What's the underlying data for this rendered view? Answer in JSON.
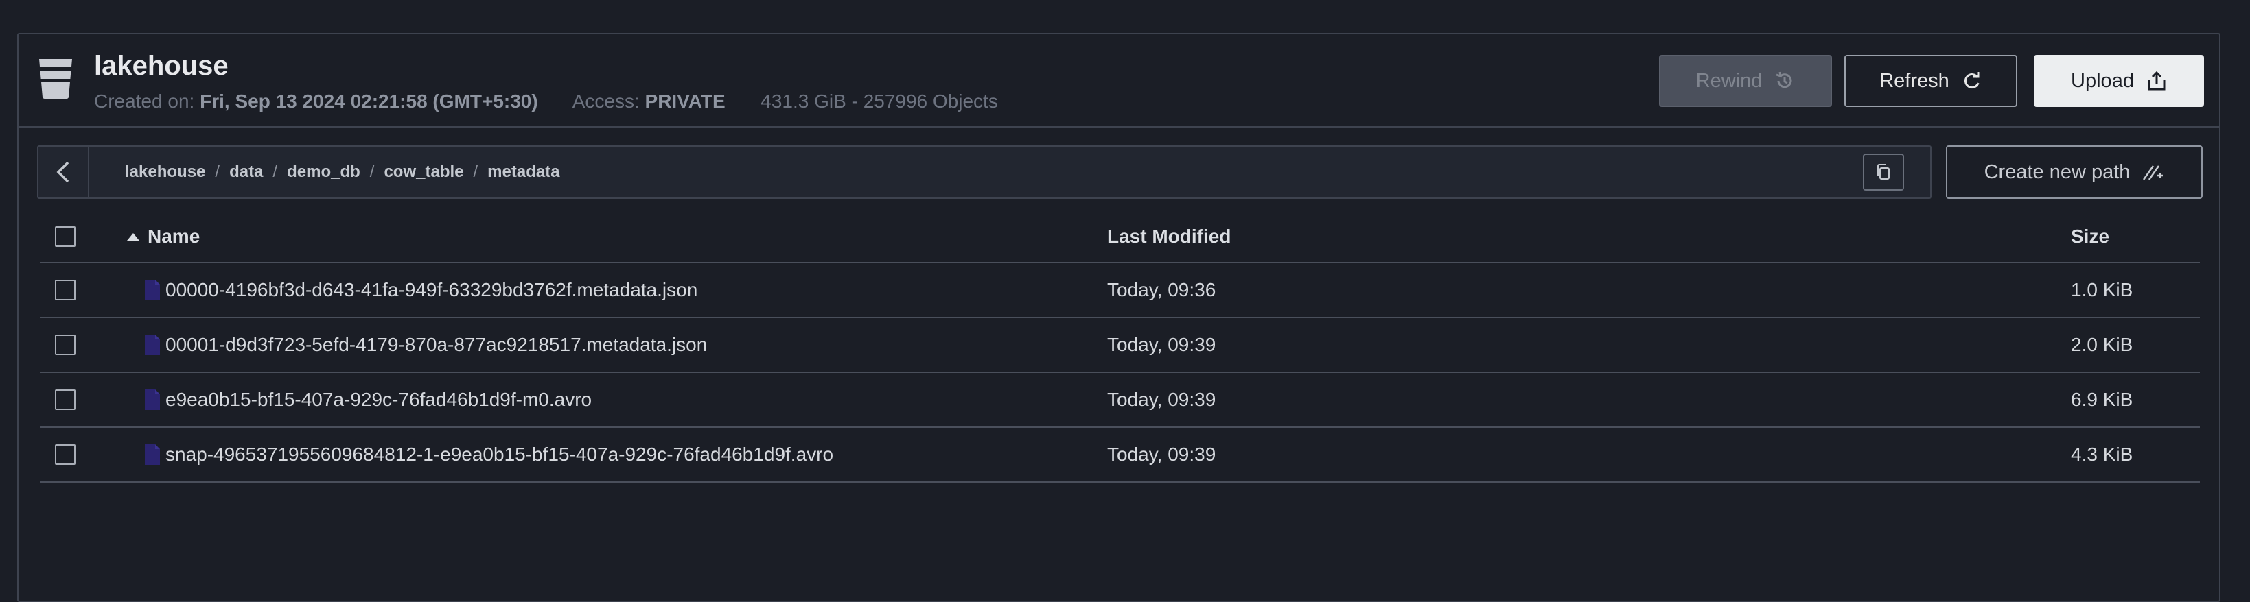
{
  "bucket": {
    "name": "lakehouse",
    "created_label": "Created on:",
    "created_value": "Fri, Sep 13 2024 02:21:58 (GMT+5:30)",
    "access_label": "Access:",
    "access_value": "PRIVATE",
    "usage": "431.3 GiB - 257996 Objects"
  },
  "actions": {
    "rewind": "Rewind",
    "refresh": "Refresh",
    "upload": "Upload",
    "create_path": "Create new path"
  },
  "breadcrumb": [
    "lakehouse",
    "data",
    "demo_db",
    "cow_table",
    "metadata"
  ],
  "table": {
    "headers": {
      "name": "Name",
      "modified": "Last Modified",
      "size": "Size"
    },
    "rows": [
      {
        "name": "00000-4196bf3d-d643-41fa-949f-63329bd3762f.metadata.json",
        "modified": "Today, 09:36",
        "size": "1.0 KiB"
      },
      {
        "name": "00001-d9d3f723-5efd-4179-870a-877ac9218517.metadata.json",
        "modified": "Today, 09:39",
        "size": "2.0 KiB"
      },
      {
        "name": "e9ea0b15-bf15-407a-929c-76fad46b1d9f-m0.avro",
        "modified": "Today, 09:39",
        "size": "6.9 KiB"
      },
      {
        "name": "snap-4965371955609684812-1-e9ea0b15-bf15-407a-929c-76fad46b1d9f.avro",
        "modified": "Today, 09:39",
        "size": "4.3 KiB"
      }
    ]
  },
  "colors": {
    "background": "#1b1e26",
    "file_icon": "#2b2470",
    "upload_button": "#eceef0"
  }
}
